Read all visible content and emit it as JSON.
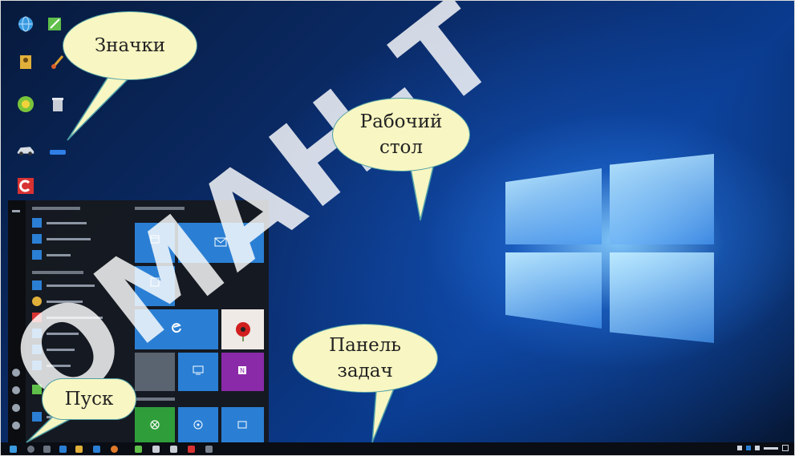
{
  "callouts": {
    "icons": "Значки",
    "desktop_line1": "Рабочий",
    "desktop_line2": "стол",
    "taskbar_line1": "Панель",
    "taskbar_line2": "задач",
    "start": "Пуск"
  },
  "watermark": "ОМАН-Т",
  "desktop_icons": [
    {
      "name": "globe-icon",
      "color": "#3b9be0"
    },
    {
      "name": "edit-app-icon",
      "color": "#5fbf4a"
    },
    {
      "name": "user-folder-icon",
      "color": "#e0b03a"
    },
    {
      "name": "paint-icon",
      "color": "#e0a030"
    },
    {
      "name": "antivirus-icon",
      "color": "#7ac43a"
    },
    {
      "name": "recycle-bin-icon",
      "color": "#c9ced6"
    },
    {
      "name": "car-icon",
      "color": "#d8dde4"
    },
    {
      "name": "drive-icon",
      "color": "#2f7ee6"
    },
    {
      "name": "app-red-icon",
      "color": "#d83232"
    }
  ],
  "colors": {
    "callout_fill": "#f8f6c2",
    "callout_border": "#4fa0a6",
    "tile_blue": "#2a7fd4",
    "tile_green": "#2f9e3a",
    "tile_purple": "#8a2aa8",
    "taskbar": "#0a0d14"
  }
}
